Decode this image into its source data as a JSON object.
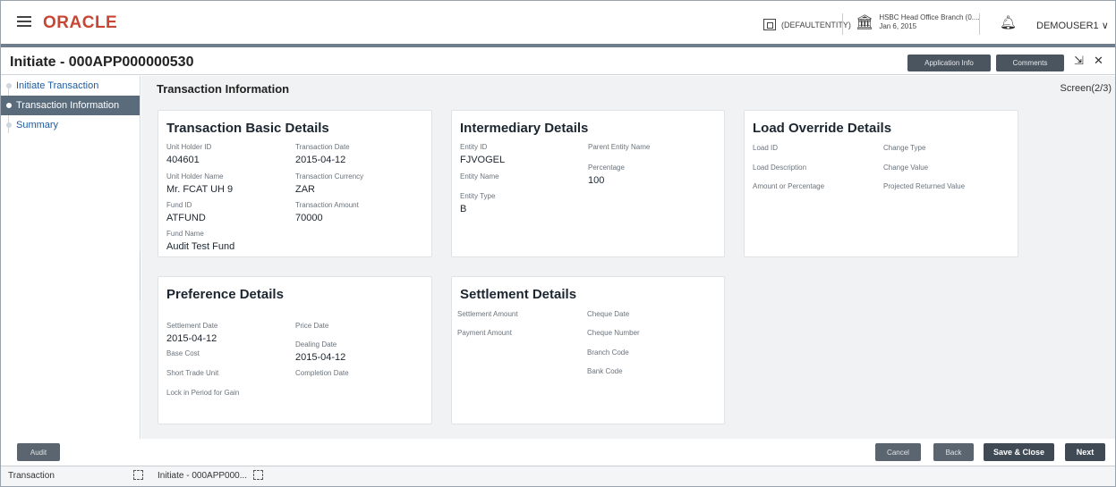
{
  "header": {
    "brand": "ORACLE",
    "entity": "(DEFAULTENTITY)",
    "branch_line1": "HSBC Head Office Branch (0....",
    "branch_line2": "Jan 6, 2015",
    "user": "DEMOUSER1 ∨"
  },
  "titlebar": {
    "title": "Initiate - 000APP000000530",
    "application_info": "Application Info",
    "comments": "Comments",
    "collapse_glyph": "⇲",
    "close_glyph": "✕"
  },
  "sidebar": {
    "items": [
      {
        "label": "Initiate Transaction"
      },
      {
        "label": "Transaction Information"
      },
      {
        "label": "Summary"
      }
    ]
  },
  "main": {
    "section_title": "Transaction Information",
    "screen_label": "Screen(2/3)"
  },
  "basic": {
    "title": "Transaction Basic Details",
    "unit_holder_id_label": "Unit Holder ID",
    "unit_holder_id": "404601",
    "transaction_date_label": "Transaction Date",
    "transaction_date": "2015-04-12",
    "unit_holder_name_label": "Unit Holder Name",
    "unit_holder_name": "Mr. FCAT UH 9",
    "transaction_currency_label": "Transaction Currency",
    "transaction_currency": "ZAR",
    "fund_id_label": "Fund ID",
    "fund_id": "ATFUND",
    "transaction_amount_label": "Transaction Amount",
    "transaction_amount": "70000",
    "fund_name_label": "Fund Name",
    "fund_name": "Audit Test Fund"
  },
  "intermediary": {
    "title": "Intermediary Details",
    "entity_id_label": "Entity ID",
    "entity_id": "FJVOGEL",
    "parent_entity_name_label": "Parent Entity Name",
    "entity_name_label": "Entity Name",
    "percentage_label": "Percentage",
    "percentage": "100",
    "entity_type_label": "Entity Type",
    "entity_type": "B"
  },
  "load_override": {
    "title": "Load Override Details",
    "load_id_label": "Load ID",
    "change_type_label": "Change Type",
    "load_description_label": "Load Description",
    "change_value_label": "Change Value",
    "amount_or_percentage_label": "Amount or Percentage",
    "projected_returned_value_label": "Projected Returned Value"
  },
  "preference": {
    "title": "Preference Details",
    "settlement_date_label": "Settlement Date",
    "settlement_date": "2015-04-12",
    "price_date_label": "Price Date",
    "dealing_date_label": "Dealing Date",
    "dealing_date": "2015-04-12",
    "base_cost_label": "Base Cost",
    "short_trade_unit_label": "Short Trade Unit",
    "completion_date_label": "Completion Date",
    "lock_in_label": "Lock in Period for Gain"
  },
  "settlement": {
    "title": "Settlement Details",
    "settlement_amount_label": "Settlement Amount",
    "cheque_date_label": "Cheque Date",
    "payment_amount_label": "Payment Amount",
    "cheque_number_label": "Cheque Number",
    "branch_code_label": "Branch Code",
    "bank_code_label": "Bank Code"
  },
  "footer": {
    "audit": "Audit",
    "cancel": "Cancel",
    "back": "Back",
    "save_close": "Save & Close",
    "next": "Next"
  },
  "taskbar": {
    "tab1": "Transaction",
    "tab2": "Initiate - 000APP000..."
  }
}
